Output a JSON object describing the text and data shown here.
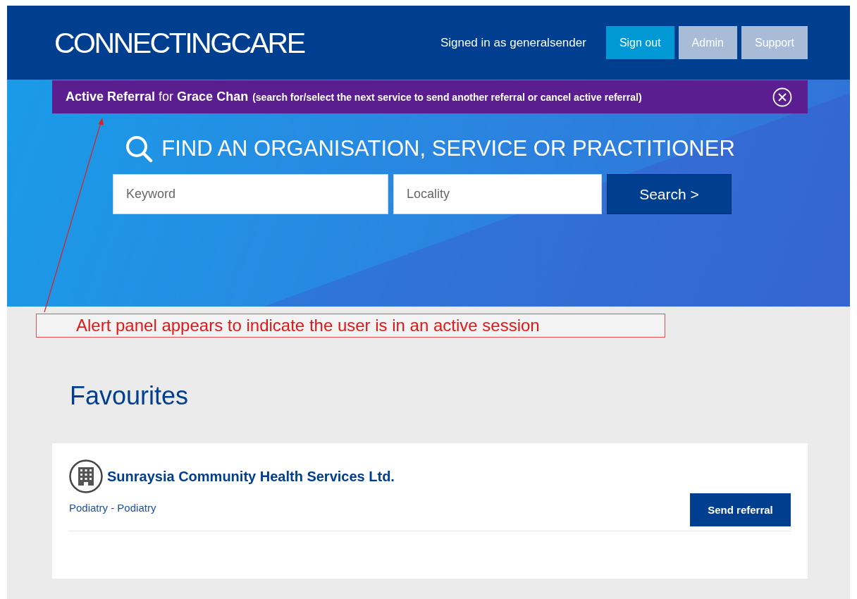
{
  "header": {
    "logo": "CONNECTINGCARE",
    "signed_in": "Signed in as generalsender",
    "buttons": [
      {
        "label": "Sign out",
        "kind": "primary"
      },
      {
        "label": "Admin",
        "kind": "muted"
      },
      {
        "label": "Support",
        "kind": "muted"
      }
    ]
  },
  "alert": {
    "message": "**Active Referral** for **Grace Chan**",
    "hint": "(search for/select the next service to send another referral or cancel active referral)"
  },
  "search": {
    "title": "FIND AN ORGANISATION, SERVICE OR PRACTITIONER",
    "keyword": {
      "placeholder": "Keyword"
    },
    "locality": {
      "placeholder": "Locality"
    },
    "button": "Search >"
  },
  "annotation": {
    "text": "Alert panel appears to indicate the user is in an active session"
  },
  "favourites": {
    "heading": "Favourites",
    "items": [
      {
        "name": "Sunraysia Community Health Services Ltd.",
        "service": "Podiatry - Podiatry",
        "action": "Send referral"
      }
    ]
  }
}
